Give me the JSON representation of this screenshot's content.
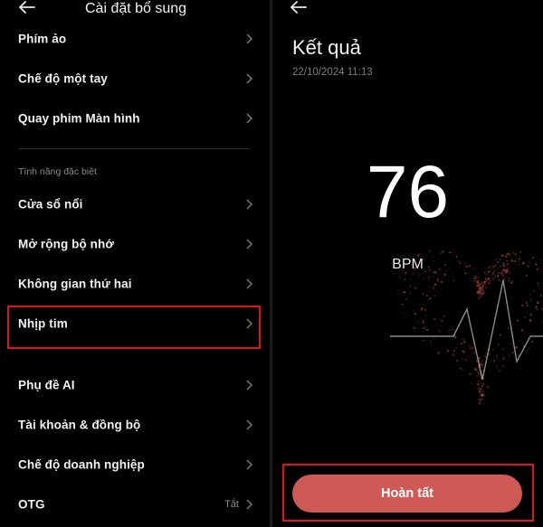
{
  "settings": {
    "title": "Cài đặt bổ sung",
    "items_top": [
      {
        "label": "Phím ảo"
      },
      {
        "label": "Chế độ một tay"
      },
      {
        "label": "Quay phim Màn hình"
      }
    ],
    "section_title": "Tính năng đặc biệt",
    "items_special": [
      {
        "label": "Cửa sổ nổi"
      },
      {
        "label": "Mở rộng bộ nhớ"
      },
      {
        "label": "Không gian thứ hai"
      },
      {
        "label": "Nhịp tim"
      }
    ],
    "items_bottom": [
      {
        "label": "Phụ đề AI"
      },
      {
        "label": "Tài khoản & đồng bộ"
      },
      {
        "label": "Chế độ doanh nghiệp"
      },
      {
        "label": "OTG",
        "value": "Tắt"
      }
    ]
  },
  "result": {
    "title": "Kết quả",
    "datetime": "22/10/2024 11:13",
    "bpm_value": "76",
    "bpm_unit": "BPM",
    "done_label": "Hoàn tất"
  },
  "colors": {
    "highlight": "#e0141c",
    "done_button": "#cf5a55",
    "heart_dots": "#8a3a36"
  },
  "icons": {
    "back": "arrow-left-icon",
    "chevron": "chevron-right-icon",
    "heart": "heart-pulse-icon"
  }
}
